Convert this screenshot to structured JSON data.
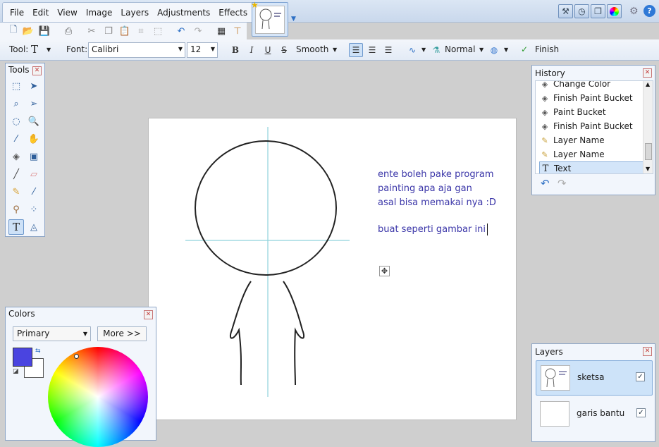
{
  "menu": [
    "File",
    "Edit",
    "View",
    "Image",
    "Layers",
    "Adjustments",
    "Effects"
  ],
  "toolbar": {
    "tool_label": "Tool:",
    "font_label": "Font:",
    "font_value": "Calibri",
    "size_value": "12",
    "bold": "B",
    "italic": "I",
    "underline": "U",
    "strike": "S",
    "smoothing": "Smooth",
    "blend_mode": "Normal",
    "finish_label": "Finish"
  },
  "tools_panel": {
    "title": "Tools"
  },
  "colors_panel": {
    "title": "Colors",
    "mode": "Primary",
    "more_label": "More >>",
    "primary_color": "#4a44e0",
    "secondary_color": "#ffffff"
  },
  "history": {
    "title": "History",
    "items": [
      {
        "label": "Change Color",
        "icon": "paint-bucket-icon"
      },
      {
        "label": "Finish Paint Bucket",
        "icon": "paint-bucket-icon"
      },
      {
        "label": "Paint Bucket",
        "icon": "paint-bucket-icon"
      },
      {
        "label": "Finish Paint Bucket",
        "icon": "paint-bucket-icon"
      },
      {
        "label": "Layer Name",
        "icon": "layer-properties-icon"
      },
      {
        "label": "Layer Name",
        "icon": "layer-properties-icon"
      },
      {
        "label": "Text",
        "icon": "text-tool-icon"
      }
    ],
    "selected_index": 6
  },
  "layers": {
    "title": "Layers",
    "items": [
      {
        "name": "sketsa",
        "visible": true,
        "selected": true
      },
      {
        "name": "garis bantu",
        "visible": true,
        "selected": false
      }
    ]
  },
  "canvas": {
    "text_lines": [
      "ente boleh pake program",
      "painting apa aja gan",
      "asal bisa memakai nya :D",
      "",
      "buat seperti gambar ini"
    ],
    "text_color": "#3a35a8"
  }
}
